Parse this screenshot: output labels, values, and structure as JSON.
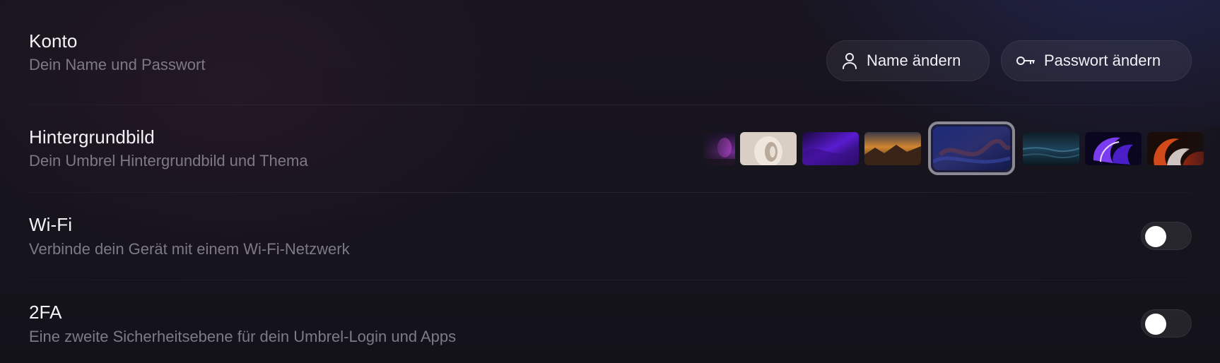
{
  "account": {
    "title": "Konto",
    "description": "Dein Name und Passwort",
    "change_name_label": "Name ändern",
    "change_password_label": "Passwort ändern",
    "change_name_icon": "user-icon",
    "change_password_icon": "key-icon"
  },
  "wallpaper": {
    "title": "Hintergrundbild",
    "description": "Dein Umbrel Hintergrundbild und Thema",
    "thumbnails": [
      {
        "name": "aurora-wallpaper"
      },
      {
        "name": "shell-wallpaper"
      },
      {
        "name": "purple-wave-wallpaper"
      },
      {
        "name": "mountain-sunset-wallpaper"
      },
      {
        "name": "blue-canyon-wallpaper",
        "selected": true
      },
      {
        "name": "ocean-wallpaper"
      },
      {
        "name": "purple-shape-wallpaper"
      },
      {
        "name": "orange-swirl-wallpaper"
      }
    ]
  },
  "wifi": {
    "title": "Wi-Fi",
    "description": "Verbinde dein Gerät mit einem Wi-Fi-Netzwerk",
    "enabled": false
  },
  "twofa": {
    "title": "2FA",
    "description": "Eine zweite Sicherheitsebene für dein Umbrel-Login und Apps",
    "enabled": false
  },
  "colors": {
    "background": "#17151e",
    "title_text": "#f4f3f7",
    "description_text": "#7d7a85",
    "toggle_track_off": "#25232c",
    "toggle_knob": "#ffffff",
    "selected_border": "#8b8a94"
  }
}
